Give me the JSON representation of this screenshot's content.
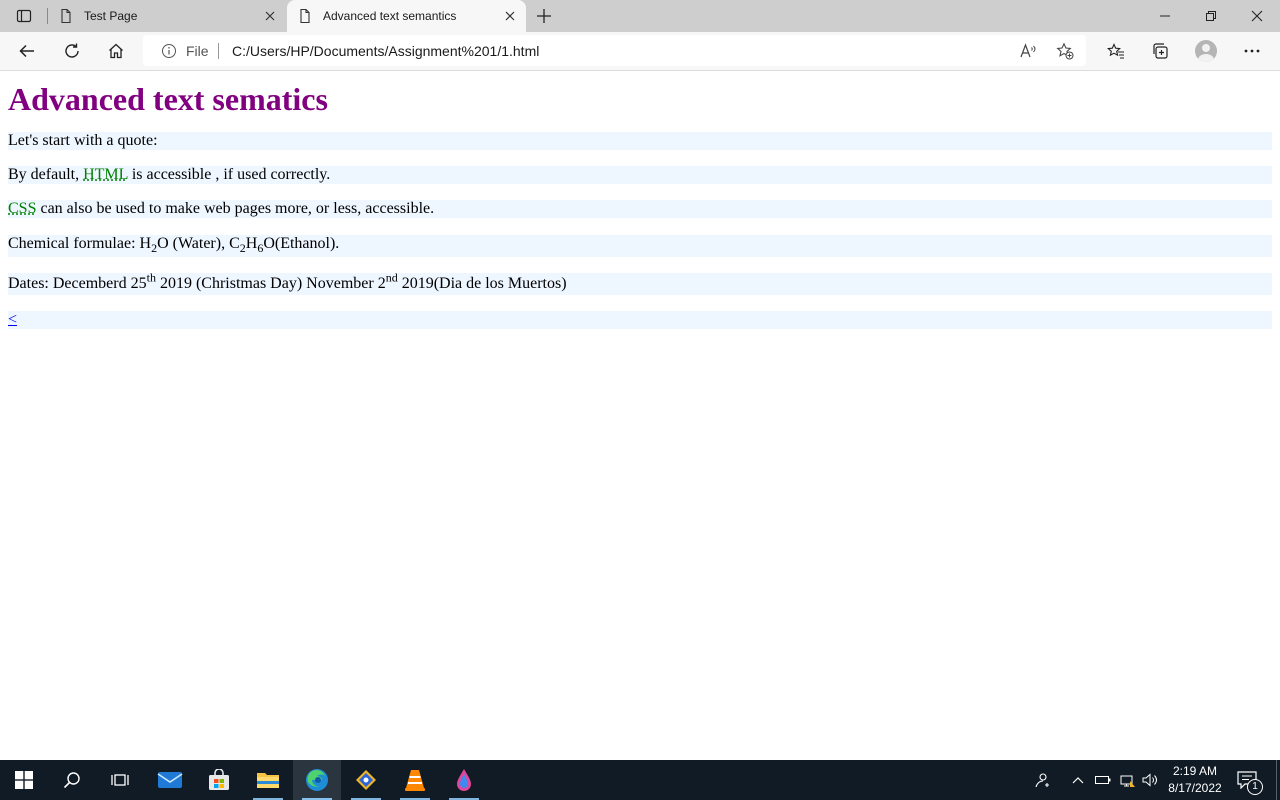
{
  "browser": {
    "tabs": [
      {
        "title": "Test Page",
        "active": false
      },
      {
        "title": "Advanced text semantics",
        "active": true
      }
    ],
    "address_bar": {
      "scheme_label": "File",
      "url": "C:/Users/HP/Documents/Assignment%201/1.html"
    }
  },
  "page": {
    "heading": "Advanced text sematics",
    "heading_color": "#800080",
    "row_background": "#eef6ff",
    "line1": "Let's start with a quote:",
    "line2": {
      "before": "By default, ",
      "abbr": "HTML",
      "after": " is accessible , if used correctly."
    },
    "line3": {
      "abbr": "CSS",
      "after": " can also be used to make web pages more, or less, accessible."
    },
    "line4": {
      "prefix": "Chemical formulae: ",
      "w1": "H",
      "w_sub": "2",
      "w2": "O (Water), ",
      "e1": "C",
      "e_sub1": "2",
      "e2": "H",
      "e_sub2": "6",
      "e3": "O(Ethanol)."
    },
    "line5": {
      "prefix": "Dates: Decemberd 25",
      "sup1": "th",
      "mid": " 2019 (Christmas Day) November 2",
      "sup2": "nd",
      "suffix": " 2019(Dia de los Muertos)"
    },
    "back_link": "<"
  },
  "taskbar": {
    "time": "2:19 AM",
    "date": "8/17/2022",
    "notification_count": "1"
  }
}
